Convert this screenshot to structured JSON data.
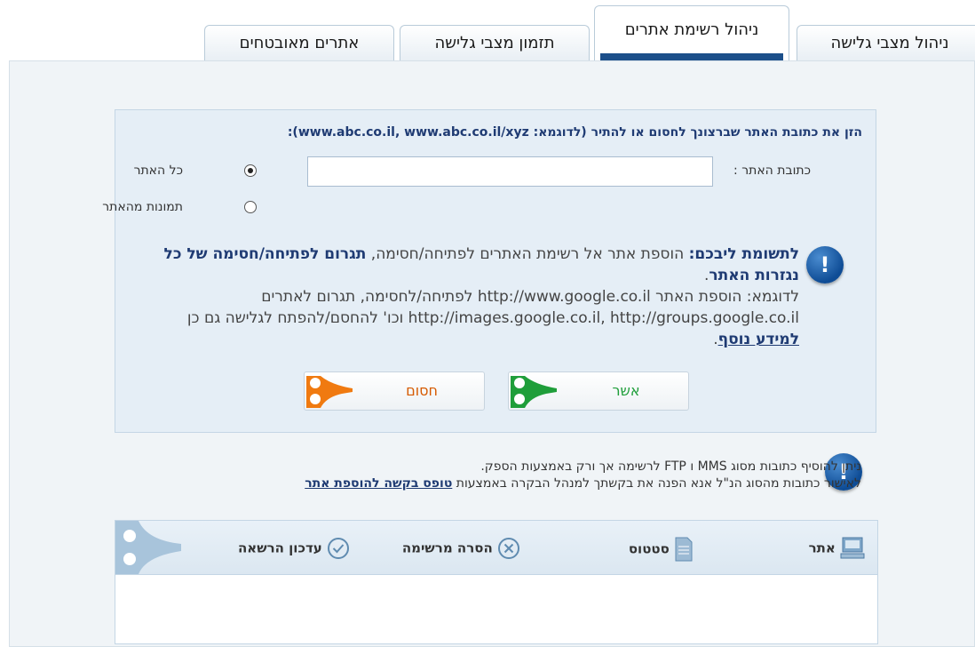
{
  "tabs": [
    {
      "label": "ניהול מצבי גלישה"
    },
    {
      "label": "ניהול רשימת אתרים"
    },
    {
      "label": "תזמון מצבי גלישה"
    },
    {
      "label": "אתרים מאובטחים"
    }
  ],
  "form": {
    "instruction": "הזן את כתובת האתר שברצונך לחסום או להתיר (לדוגמא: www.abc.co.il, www.abc.co.il/xyz):",
    "url_label": "כתובת האתר :",
    "url_value": "",
    "radio_whole_site": "כל האתר",
    "radio_site_images": "תמונות מהאתר"
  },
  "notice": {
    "heading": "לתשומת ליבכם:",
    "text1": " הוספת אתר אל רשימת האתרים לפתיחה/חסימה, ",
    "bold1": "תגרום לפתיחה/חסימה של כל נגזרות האתר",
    "text2": ".",
    "example": "לדוגמא: הוספת האתר http://www.google.co.il לפתיחה/לחסימה, תגרום לאתרים http://images.google.co.il, http://groups.google.co.il וכו' להחסם/להפתח לגלישה גם כן ",
    "link": "למידע נוסף",
    "end": "."
  },
  "buttons": {
    "confirm_label": "אשר",
    "block_label": "חסום"
  },
  "note2": {
    "line1": "ניתן להוסיף כתובות מסוג MMS ו FTP לרשימה אך ורק באמצעות הספק.",
    "line2_text": "לאישור כתובות מהסוג הנ\"ל אנא הפנה את בקשתך למנהל הבקרה באמצעות ",
    "line2_link": "טופס בקשה להוספת אתר"
  },
  "table": {
    "columns": [
      {
        "label": "אתר",
        "icon": "monitor-icon"
      },
      {
        "label": "סטטוס",
        "icon": "document-icon"
      },
      {
        "label": "הסרה מרשימה",
        "icon": "remove-circle-icon"
      },
      {
        "label": "עדכון הרשאה",
        "icon": "check-circle-icon"
      }
    ]
  },
  "colors": {
    "navy": "#1f3b73",
    "tab_underline": "#1c4f8a",
    "confirm_green": "#1f9e3a",
    "block_orange": "#f07a10"
  }
}
